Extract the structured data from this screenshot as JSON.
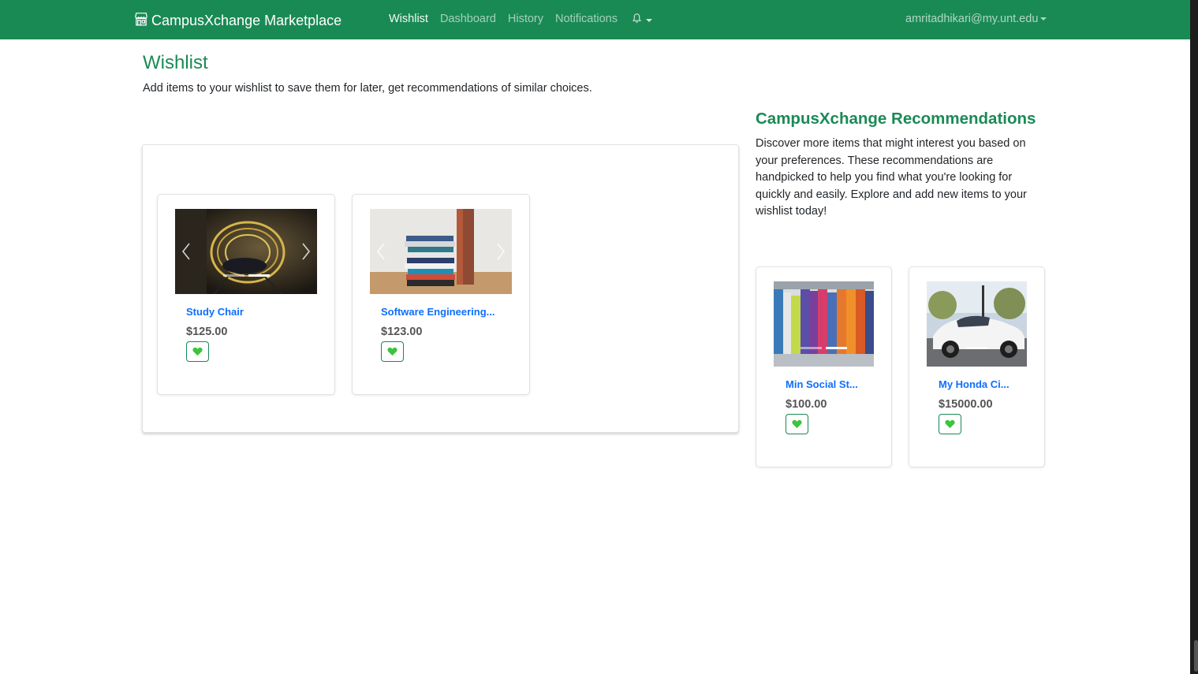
{
  "navbar": {
    "brand": "CampusXchange Marketplace",
    "links": [
      {
        "label": "Wishlist",
        "active": true
      },
      {
        "label": "Dashboard",
        "active": false
      },
      {
        "label": "History",
        "active": false
      },
      {
        "label": "Notifications",
        "active": false
      }
    ],
    "user": "amritadhikari@my.unt.edu"
  },
  "wishlist": {
    "title": "Wishlist",
    "subtitle": "Add items to your wishlist to save them for later, get recommendations of similar choices.",
    "items": [
      {
        "title": "Study Chair",
        "price": "$125.00",
        "image": "chair-photo"
      },
      {
        "title": "Software Engineering...",
        "price": "$123.00",
        "image": "books-stack-photo"
      }
    ]
  },
  "recommendations": {
    "title": "CampusXchange Recommendations",
    "description": "Discover more items that might interest you based on your preferences. These recommendations are handpicked to help you find what you're looking for quickly and easily. Explore and add new items to your wishlist today!",
    "items": [
      {
        "title": "Min Social St...",
        "price": "$100.00",
        "image": "bookshelf-photo"
      },
      {
        "title": "My Honda Ci...",
        "price": "$15000.00",
        "image": "white-car-photo"
      }
    ]
  },
  "colors": {
    "brand_green": "#1a8a55",
    "link_blue": "#0d6efd",
    "heart_green": "#3cc43c"
  },
  "icons": {
    "brand": "store-icon",
    "notifications": "bell-icon",
    "wishlist_toggle": "green-heart-icon"
  }
}
